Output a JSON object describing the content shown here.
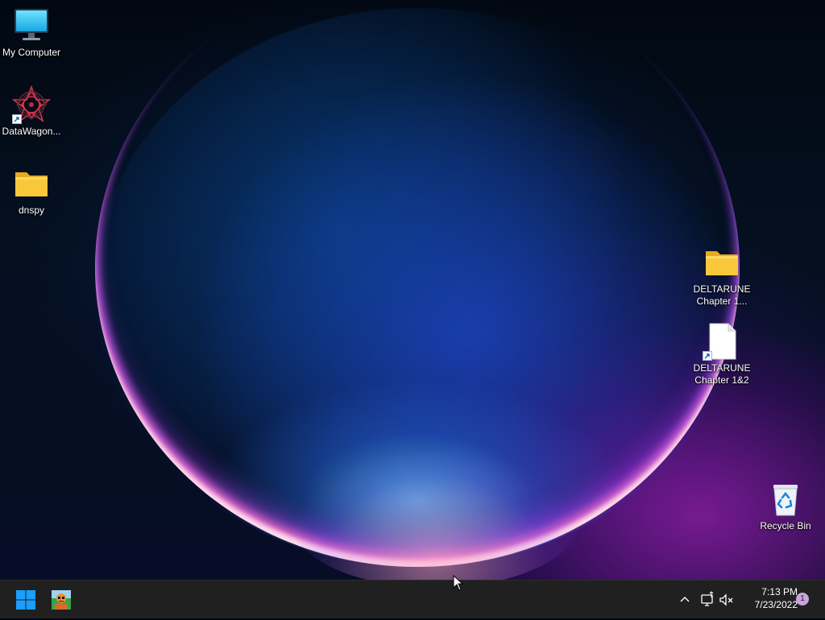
{
  "desktop": {
    "icons": [
      {
        "label": "My Computer",
        "icon": "monitor-icon"
      },
      {
        "label": "DataWagon...",
        "icon": "datawagon-app-icon",
        "shortcut": true
      },
      {
        "label": "dnspy",
        "icon": "folder-icon"
      },
      {
        "label": "DELTARUNE\nChapter 1...",
        "icon": "folder-icon"
      },
      {
        "label": "DELTARUNE\nChapter 1&2",
        "icon": "blank-file-icon",
        "shortcut": true
      },
      {
        "label": "Recycle Bin",
        "icon": "recycle-bin-icon"
      }
    ]
  },
  "taskbar": {
    "start_icon": "windows-start-icon",
    "pinned_app_icon": "orange-character-app-icon",
    "tray": {
      "chevron_icon": "show-hidden-icons-chevron",
      "network_icon": "network-icon",
      "volume_icon": "volume-muted-icon"
    },
    "clock": {
      "time": "7:13 PM",
      "date": "7/23/2022"
    },
    "notification_count": "1"
  },
  "colors": {
    "taskbar_bg": "#202020",
    "start_blue": "#1a9fff",
    "folder_yellow": "#f8c83a",
    "badge": "#c9a3de"
  }
}
